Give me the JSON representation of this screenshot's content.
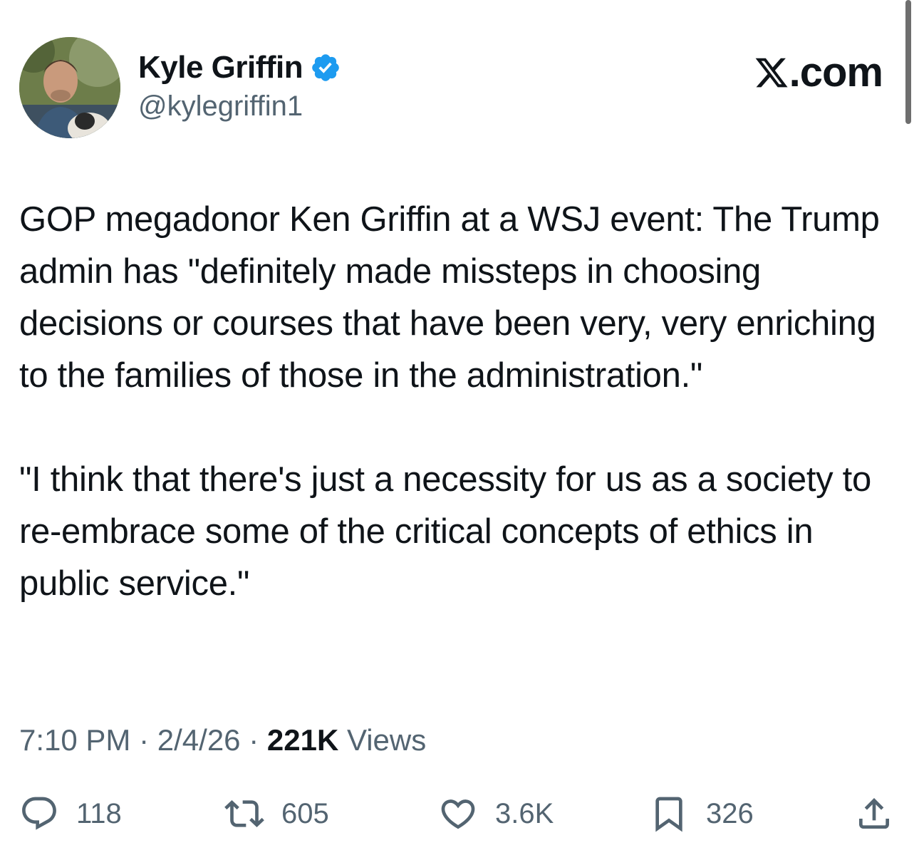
{
  "author": {
    "display_name": "Kyle Griffin",
    "handle": "@kylegriffin1",
    "verified_icon": "verified-badge-icon",
    "verified_color": "#1d9bf0"
  },
  "brand": {
    "icon": "x-logo-icon",
    "label": ".com"
  },
  "tweet": {
    "paragraphs": [
      "GOP megadonor Ken Griffin at a WSJ event: The Trump admin has \"definitely made missteps in choosing decisions or courses that have been very, very enriching to the families of those in the administration.\"",
      "\"I think that there's just a necessity for us as a society to re-embrace some of the critical concepts of ethics in public service.\""
    ]
  },
  "meta": {
    "time": "7:10 PM",
    "separator": "·",
    "date": "2/4/26",
    "views_count": "221K",
    "views_label": "Views"
  },
  "actions": {
    "reply": {
      "icon": "reply-icon",
      "count": "118"
    },
    "repost": {
      "icon": "repost-icon",
      "count": "605"
    },
    "like": {
      "icon": "heart-icon",
      "count": "3.6K"
    },
    "bookmark": {
      "icon": "bookmark-icon",
      "count": "326"
    },
    "share": {
      "icon": "share-icon"
    }
  },
  "colors": {
    "text": "#0f1419",
    "secondary": "#536471",
    "accent": "#1d9bf0"
  }
}
